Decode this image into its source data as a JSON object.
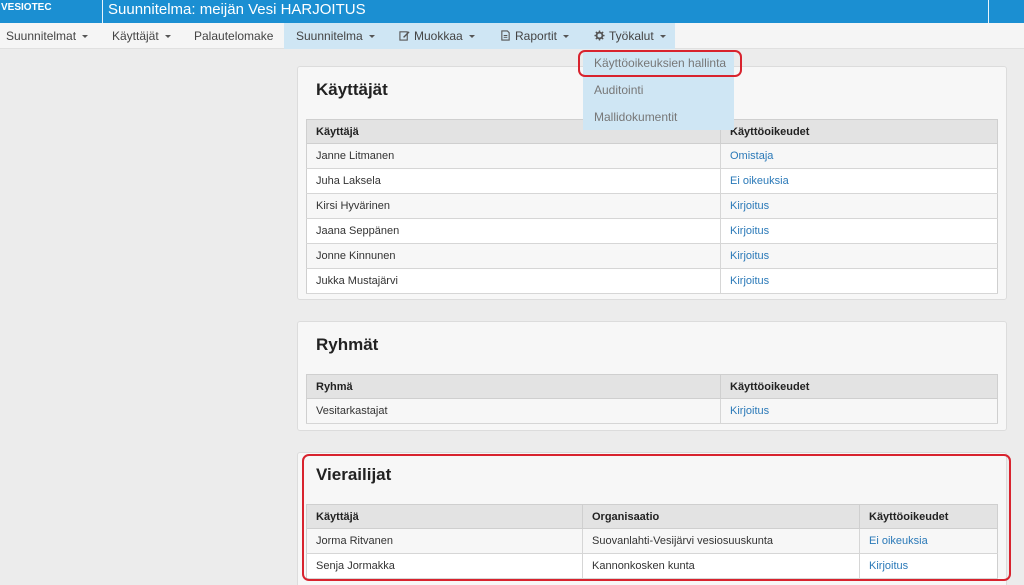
{
  "header": {
    "brand": "VESIOTEC",
    "plan_title": "Suunnitelma: meijän Vesi HARJOITUS"
  },
  "nav": {
    "suunnitelmat": "Suunnitelmat",
    "kayttajat": "Käyttäjät",
    "palautelomake": "Palautelomake",
    "suunnitelma": "Suunnitelma",
    "muokkaa": "Muokkaa",
    "raportit": "Raportit",
    "tyokalut": "Työkalut"
  },
  "dropdown": {
    "items": [
      "Käyttöoikeuksien hallinta",
      "Auditointi",
      "Mallidokumentit"
    ]
  },
  "users_panel": {
    "title": "Käyttäjät",
    "columns": [
      "Käyttäjä",
      "Käyttöoikeudet"
    ],
    "rows": [
      {
        "name": "Janne Litmanen",
        "rights": "Omistaja"
      },
      {
        "name": "Juha Laksela",
        "rights": "Ei oikeuksia"
      },
      {
        "name": "Kirsi Hyvärinen",
        "rights": "Kirjoitus"
      },
      {
        "name": "Jaana Seppänen",
        "rights": "Kirjoitus"
      },
      {
        "name": "Jonne Kinnunen",
        "rights": "Kirjoitus"
      },
      {
        "name": "Jukka Mustajärvi",
        "rights": "Kirjoitus"
      }
    ]
  },
  "groups_panel": {
    "title": "Ryhmät",
    "columns": [
      "Ryhmä",
      "Käyttöoikeudet"
    ],
    "rows": [
      {
        "name": "Vesitarkastajat",
        "rights": "Kirjoitus"
      }
    ]
  },
  "visitors_panel": {
    "title": "Vierailijat",
    "columns": [
      "Käyttäjä",
      "Organisaatio",
      "Käyttöoikeudet"
    ],
    "rows": [
      {
        "name": "Jorma Ritvanen",
        "org": "Suovanlahti-Vesijärvi vesiosuuskunta",
        "rights": "Ei oikeuksia"
      },
      {
        "name": "Senja Jormakka",
        "org": "Kannonkosken kunta",
        "rights": "Kirjoitus"
      }
    ]
  },
  "colors": {
    "header": "#1b8fd2",
    "nav_active": "#cfe6f4",
    "link": "#2a79b8",
    "highlight": "#d8232e"
  }
}
